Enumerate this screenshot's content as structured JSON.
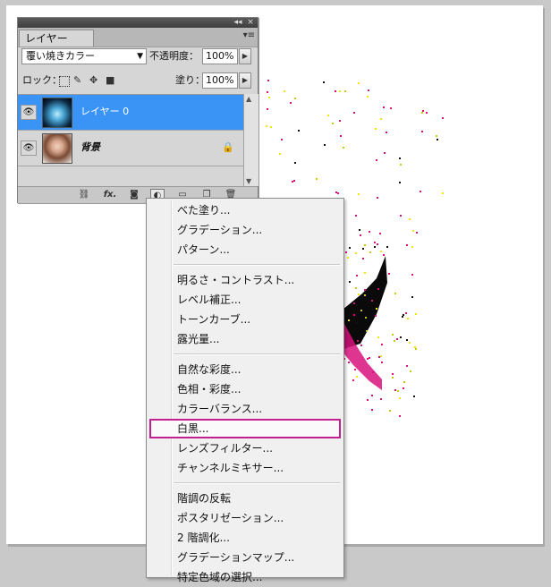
{
  "panel": {
    "tab_label": "レイヤー",
    "titlebar_collapse": "◂◂",
    "titlebar_close": "×",
    "menu_icon": "▾≡",
    "blend_mode": "覆い焼きカラー",
    "opacity_label": "不透明度：",
    "opacity_value": "100%",
    "lock_label": "ロック：",
    "fill_label": "塗り：",
    "fill_value": "100%",
    "layers": [
      {
        "name": "レイヤー 0",
        "selected": true,
        "locked": false,
        "visible": true
      },
      {
        "name": "背景",
        "selected": false,
        "locked": true,
        "visible": true
      }
    ],
    "footer_icons": [
      "link-icon",
      "fx-icon",
      "mask-icon",
      "adjustment-layer-icon",
      "group-icon",
      "new-layer-icon",
      "trash-icon"
    ],
    "fx_label": "fx."
  },
  "menu": {
    "groups": [
      [
        "べた塗り...",
        "グラデーション...",
        "パターン..."
      ],
      [
        "明るさ・コントラスト...",
        "レベル補正...",
        "トーンカーブ...",
        "露光量..."
      ],
      [
        "自然な彩度...",
        "色相・彩度...",
        "カラーバランス...",
        "白黒...",
        "レンズフィルター...",
        "チャンネルミキサー..."
      ],
      [
        "階調の反転",
        "ポスタリゼーション...",
        "2 階調化...",
        "グラデーションマップ...",
        "特定色域の選択..."
      ]
    ],
    "highlighted": "白黒..."
  },
  "colors": {
    "selection_blue": "#3a94f6",
    "highlight_border": "#c21f8f",
    "canvas_bg": "#ffffff",
    "workspace_bg": "#c9c9c9"
  }
}
